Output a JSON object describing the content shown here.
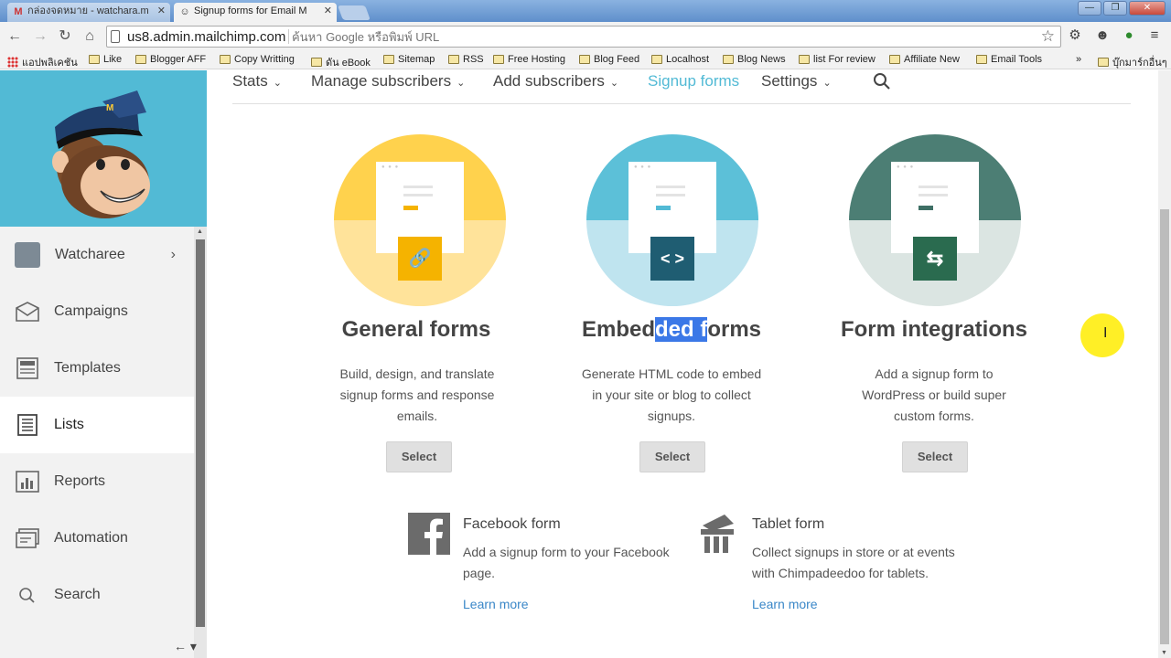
{
  "browser": {
    "tabs": [
      {
        "title": "กล่องจดหมาย - watchara.m",
        "active": false,
        "favicon": "gmail-icon"
      },
      {
        "title": "Signup forms for Email M",
        "active": true,
        "favicon": "mailchimp-icon"
      }
    ],
    "address": "us8.admin.mailchimp.com",
    "omnibox_placeholder": "ค้นหา Google หรือพิมพ์ URL",
    "bookmarks": [
      "แอปพลิเคชัน",
      "Like",
      "Blogger AFF",
      "Copy Writting",
      "ดัน eBook",
      "Sitemap",
      "RSS",
      "Free Hosting",
      "Blog Feed",
      "Localhost",
      "Blog News",
      "list For review",
      "Affiliate New",
      "Email Tools",
      "»",
      "บุ๊กมาร์กอื่นๆ"
    ]
  },
  "sidebar": {
    "user": "Watcharee",
    "items": [
      {
        "label": "Campaigns",
        "icon": "envelope-icon"
      },
      {
        "label": "Templates",
        "icon": "template-icon"
      },
      {
        "label": "Lists",
        "icon": "list-icon",
        "active": true
      },
      {
        "label": "Reports",
        "icon": "bar-chart-icon"
      },
      {
        "label": "Automation",
        "icon": "automation-icon"
      },
      {
        "label": "Search",
        "icon": "search-icon"
      }
    ]
  },
  "subnav": {
    "items": [
      "Stats",
      "Manage subscribers",
      "Add subscribers",
      "Signup forms",
      "Settings"
    ],
    "current": "Signup forms"
  },
  "cards": [
    {
      "title": "General forms",
      "desc": "Build, design, and translate signup forms and response emails.",
      "button": "Select",
      "icon": "link-icon",
      "colors": {
        "top": "#ffd24d",
        "bottom": "#ffe39a",
        "badge": "#f5b300",
        "accent": "#f5b300"
      }
    },
    {
      "title_pre": "Embed",
      "title_sel": "ded f",
      "title_post": "orms",
      "desc": "Generate HTML code to embed in your site or blog to collect signups.",
      "button": "Select",
      "icon": "code-icon",
      "colors": {
        "top": "#5cc0d8",
        "bottom": "#bfe4ef",
        "badge": "#1f5d72",
        "accent": "#52bad5"
      }
    },
    {
      "title": "Form integrations",
      "desc": "Add a signup form to WordPress or build super custom forms.",
      "button": "Select",
      "icon": "swap-arrows-icon",
      "colors": {
        "top": "#4c7e74",
        "bottom": "#dbe5e2",
        "badge": "#2a6b4f",
        "accent": "#3e6f65"
      }
    }
  ],
  "extras": [
    {
      "title": "Facebook form",
      "desc": "Add a signup form to your Facebook page.",
      "link": "Learn more",
      "icon": "facebook-icon"
    },
    {
      "title": "Tablet form",
      "desc": "Collect signups in store or at events with Chimpadeedoo for tablets.",
      "link": "Learn more",
      "icon": "tablet-chimp-icon"
    }
  ]
}
